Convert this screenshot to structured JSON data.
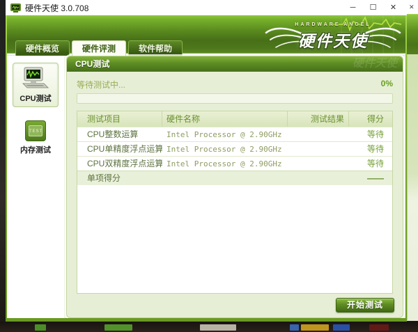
{
  "window": {
    "title": "硬件天使 3.0.708",
    "controls": {
      "minimize": "─",
      "maximize": "☐",
      "close": "✕"
    }
  },
  "background_window": {
    "close_glyph": "✕"
  },
  "header": {
    "logo": {
      "top": "HARDWARE ANGEL",
      "main": "硬件天使"
    },
    "tabs": [
      {
        "label": "硬件概览",
        "active": false
      },
      {
        "label": "硬件评测",
        "active": true
      },
      {
        "label": "软件帮助",
        "active": false
      }
    ]
  },
  "sidebar": {
    "items": [
      {
        "label": "CPU测试",
        "selected": true,
        "icon": "computer-monitor-icon"
      },
      {
        "label": "内存测试",
        "selected": false,
        "icon": "memory-chip-icon",
        "icon_text": "TEST"
      }
    ]
  },
  "main": {
    "section_title": "CPU测试",
    "status_text": "等待测试中...",
    "progress_percent": "0%",
    "table": {
      "headers": [
        "测试项目",
        "硬件名称",
        "测试结果",
        "得分"
      ],
      "rows": [
        {
          "item": "CPU整数运算",
          "hardware": "Intel Processor @ 2.90GHz",
          "result": "",
          "score": "等待"
        },
        {
          "item": "CPU单精度浮点运算",
          "hardware": "Intel Processor @ 2.90GHz",
          "result": "",
          "score": "等待"
        },
        {
          "item": "CPU双精度浮点运算",
          "hardware": "Intel Processor @ 2.90GHz",
          "result": "",
          "score": "等待"
        }
      ],
      "footer": {
        "item": "单项得分",
        "score": "——"
      }
    },
    "start_button_label": "开始测试"
  },
  "colors": {
    "accent_green": "#6a9a22",
    "header_green_dark": "#476f18",
    "header_green_bright": "#8ec73f",
    "panel_bg": "#e7eed6",
    "table_header_bg": "#dde8c0",
    "status_text": "#97ad58",
    "wait_text": "#76a038",
    "button_green": "#5d8c23"
  }
}
